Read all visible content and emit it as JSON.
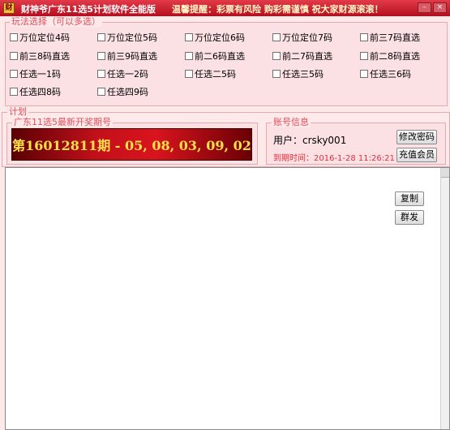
{
  "window": {
    "title": "财神爷广东11选5计划软件全能版",
    "notice": "温馨提醒：彩票有风险 购彩需谨慎  祝大家财源滚滚！",
    "icon_glyph": "财"
  },
  "play_section": {
    "legend": "玩法选择（可以多选）",
    "options": [
      "万位定位4码",
      "万位定位5码",
      "万位定位6码",
      "万位定位7码",
      "前三7码直选",
      "前三8码直选",
      "前三9码直选",
      "前二6码直选",
      "前二7码直选",
      "前二8码直选",
      "任选一1码",
      "任选一2码",
      "任选二5码",
      "任选三5码",
      "任选三6码",
      "任选四8码",
      "任选四9码"
    ]
  },
  "plan_section": {
    "legend": "计划"
  },
  "draw_section": {
    "legend": "广东11选5最新开奖期号",
    "result": "第16012811期 - 05, 08, 03, 09, 02"
  },
  "account_section": {
    "legend": "账号信息",
    "user_label": "用户：",
    "username": "crsky001",
    "expire_label": "到期时间：",
    "expire_value": "2016-1-28 11:26:21",
    "change_password": "修改密码",
    "recharge": "充值会员"
  },
  "output_panel": {
    "copy": "复制",
    "send": "群发"
  }
}
